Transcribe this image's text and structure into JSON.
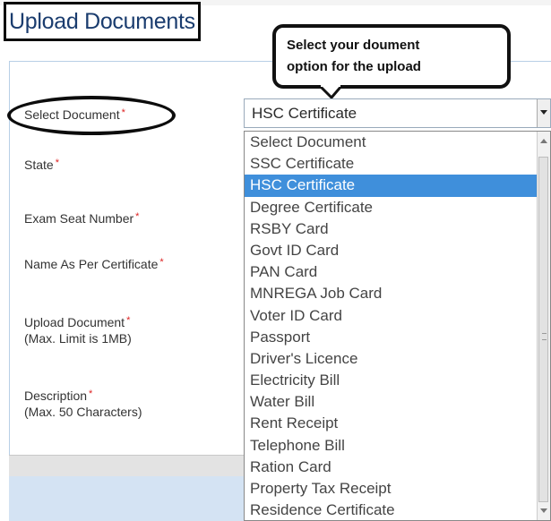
{
  "page": {
    "title": "Upload Documents"
  },
  "callout": {
    "line1": "Select your doument",
    "line2": "option for the upload"
  },
  "form": {
    "select_document": {
      "label": "Select Document",
      "required": "*",
      "value": "HSC Certificate"
    },
    "state": {
      "label": "State",
      "required": "*"
    },
    "exam_seat_number": {
      "label": "Exam Seat Number",
      "required": "*"
    },
    "name_as_per_certificate": {
      "label": "Name As Per Certificate",
      "required": "*"
    },
    "upload_document": {
      "label": "Upload Document",
      "required": "*",
      "hint": "(Max. Limit is 1MB)"
    },
    "description": {
      "label": "Description",
      "required": "*",
      "hint": "(Max. 50 Characters)"
    }
  },
  "dropdown": {
    "selected_index": 2,
    "options": [
      "Select Document",
      "SSC Certificate",
      "HSC Certificate",
      "Degree Certificate",
      "RSBY Card",
      "Govt ID Card",
      "PAN Card",
      "MNREGA Job Card",
      "Voter ID Card",
      "Passport",
      "Driver's Licence",
      "Electricity Bill",
      "Water Bill",
      "Rent Receipt",
      "Telephone Bill",
      "Ration Card",
      "Property Tax Receipt",
      "Residence Certificate"
    ]
  },
  "colors": {
    "selected_bg": "#3f8fdb",
    "required_star": "#dd2222",
    "title": "#1a3c6e"
  }
}
